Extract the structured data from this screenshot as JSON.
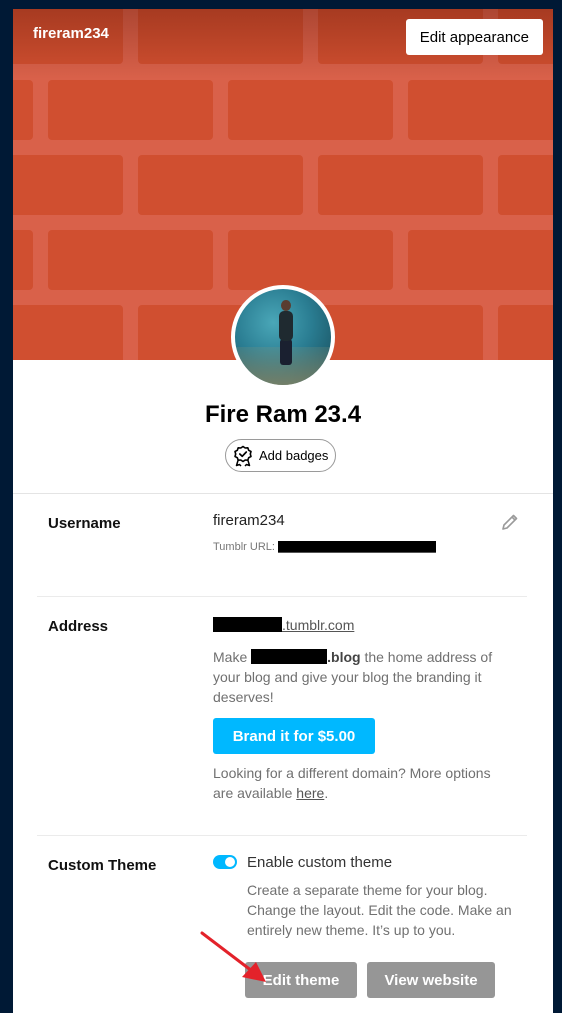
{
  "header": {
    "blog_name": "fireram234",
    "edit_appearance_label": "Edit appearance",
    "colors": {
      "background": "#d9614a",
      "brick": "#d04f30"
    }
  },
  "profile": {
    "display_name": "Fire Ram 23.4",
    "add_badges_label": "Add badges"
  },
  "username": {
    "label": "Username",
    "value": "fireram234",
    "url_label": "Tumblr URL:"
  },
  "address": {
    "label": "Address",
    "domain_suffix": ".tumblr.com",
    "desc_prefix": "Make ",
    "desc_bold_suffix": ".blog",
    "desc_rest": " the home address of your blog and give your blog the branding it deserves!",
    "brand_button_label": "Brand it for $5.00",
    "domain_note_prefix": "Looking for a different domain? More options are available ",
    "domain_note_link": "here",
    "domain_note_suffix": "."
  },
  "custom_theme": {
    "label": "Custom Theme",
    "toggle_label": "Enable custom theme",
    "toggle_on": true,
    "description": "Create a separate theme for your blog. Change the layout. Edit the code. Make an entirely new theme. It’s up to you.",
    "edit_theme_label": "Edit theme",
    "view_website_label": "View website"
  },
  "colors": {
    "frame": "#001935",
    "accent": "#00b8ff",
    "disabled_button": "#969696",
    "annotation_arrow": "#e3222a"
  }
}
